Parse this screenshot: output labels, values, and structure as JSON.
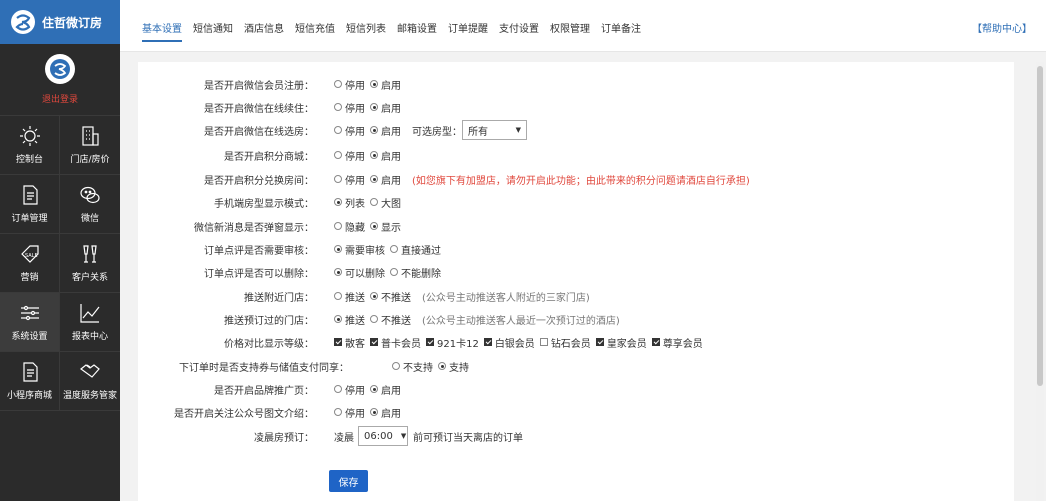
{
  "brand": {
    "name": "住哲微订房"
  },
  "profile": {
    "logout_label": "退出登录"
  },
  "nav": [
    {
      "label": "控制台",
      "icon": "sun-icon"
    },
    {
      "label": "门店/房价",
      "icon": "building-icon"
    },
    {
      "label": "订单管理",
      "icon": "document-icon"
    },
    {
      "label": "微信",
      "icon": "wechat-icon"
    },
    {
      "label": "营销",
      "icon": "sale-tag-icon"
    },
    {
      "label": "客户关系",
      "icon": "glasses-toast-icon"
    },
    {
      "label": "系统设置",
      "icon": "sliders-icon"
    },
    {
      "label": "报表中心",
      "icon": "line-chart-icon"
    },
    {
      "label": "小程序商城",
      "icon": "document-icon"
    },
    {
      "label": "温度服务管家",
      "icon": "handshake-icon"
    }
  ],
  "tabs": [
    "基本设置",
    "短信通知",
    "酒店信息",
    "短信充值",
    "短信列表",
    "邮箱设置",
    "订单提醒",
    "支付设置",
    "权限管理",
    "订单备注"
  ],
  "help_label": "【帮助中心】",
  "settings": [
    {
      "label": "是否开启微信会员注册：",
      "opts": [
        "停用",
        "启用"
      ]
    },
    {
      "label": "是否开启微信在线续住：",
      "opts": [
        "停用",
        "启用"
      ]
    },
    {
      "label": "是否开启微信在线选房：",
      "opts": [
        "停用",
        "启用"
      ],
      "extra_label": "可选房型：",
      "extra_value": "所有"
    },
    {
      "label": "是否开启积分商城：",
      "opts": [
        "停用",
        "启用"
      ]
    },
    {
      "label": "是否开启积分兑换房间：",
      "opts": [
        "停用",
        "启用"
      ],
      "note": "(如您旗下有加盟店，请勿开启此功能；由此带来的积分问题请酒店自行承担)"
    },
    {
      "label": "手机端房型显示模式：",
      "opts": [
        "列表",
        "大图"
      ]
    },
    {
      "label": "微信新消息是否弹窗显示：",
      "opts": [
        "隐藏",
        "显示"
      ]
    },
    {
      "label": "订单点评是否需要审核：",
      "opts": [
        "需要审核",
        "直接通过"
      ]
    },
    {
      "label": "订单点评是否可以删除：",
      "opts": [
        "可以删除",
        "不能删除"
      ]
    },
    {
      "label": "推送附近门店：",
      "opts": [
        "推送",
        "不推送"
      ],
      "note": "(公众号主动推送客人附近的三家门店)"
    },
    {
      "label": "推送预订过的门店：",
      "opts": [
        "推送",
        "不推送"
      ],
      "note": "(公众号主动推送客人最近一次预订过的酒店)"
    },
    {
      "label": "价格对比显示等级：",
      "checks": [
        "散客",
        "普卡会员",
        "921卡12",
        "白银会员",
        "钻石会员",
        "皇家会员",
        "尊享会员"
      ]
    },
    {
      "label": "下订单时是否支持券与储值支付同享：",
      "opts": [
        "不支持",
        "支持"
      ]
    },
    {
      "label": "是否开启品牌推广页：",
      "opts": [
        "停用",
        "启用"
      ]
    },
    {
      "label": "是否开启关注公众号图文介绍：",
      "opts": [
        "停用",
        "启用"
      ]
    },
    {
      "label": "凌晨房预订：",
      "prefix": "凌晨",
      "select": "06:00",
      "suffix": "前可预订当天离店的订单"
    }
  ],
  "save_label": "保存"
}
